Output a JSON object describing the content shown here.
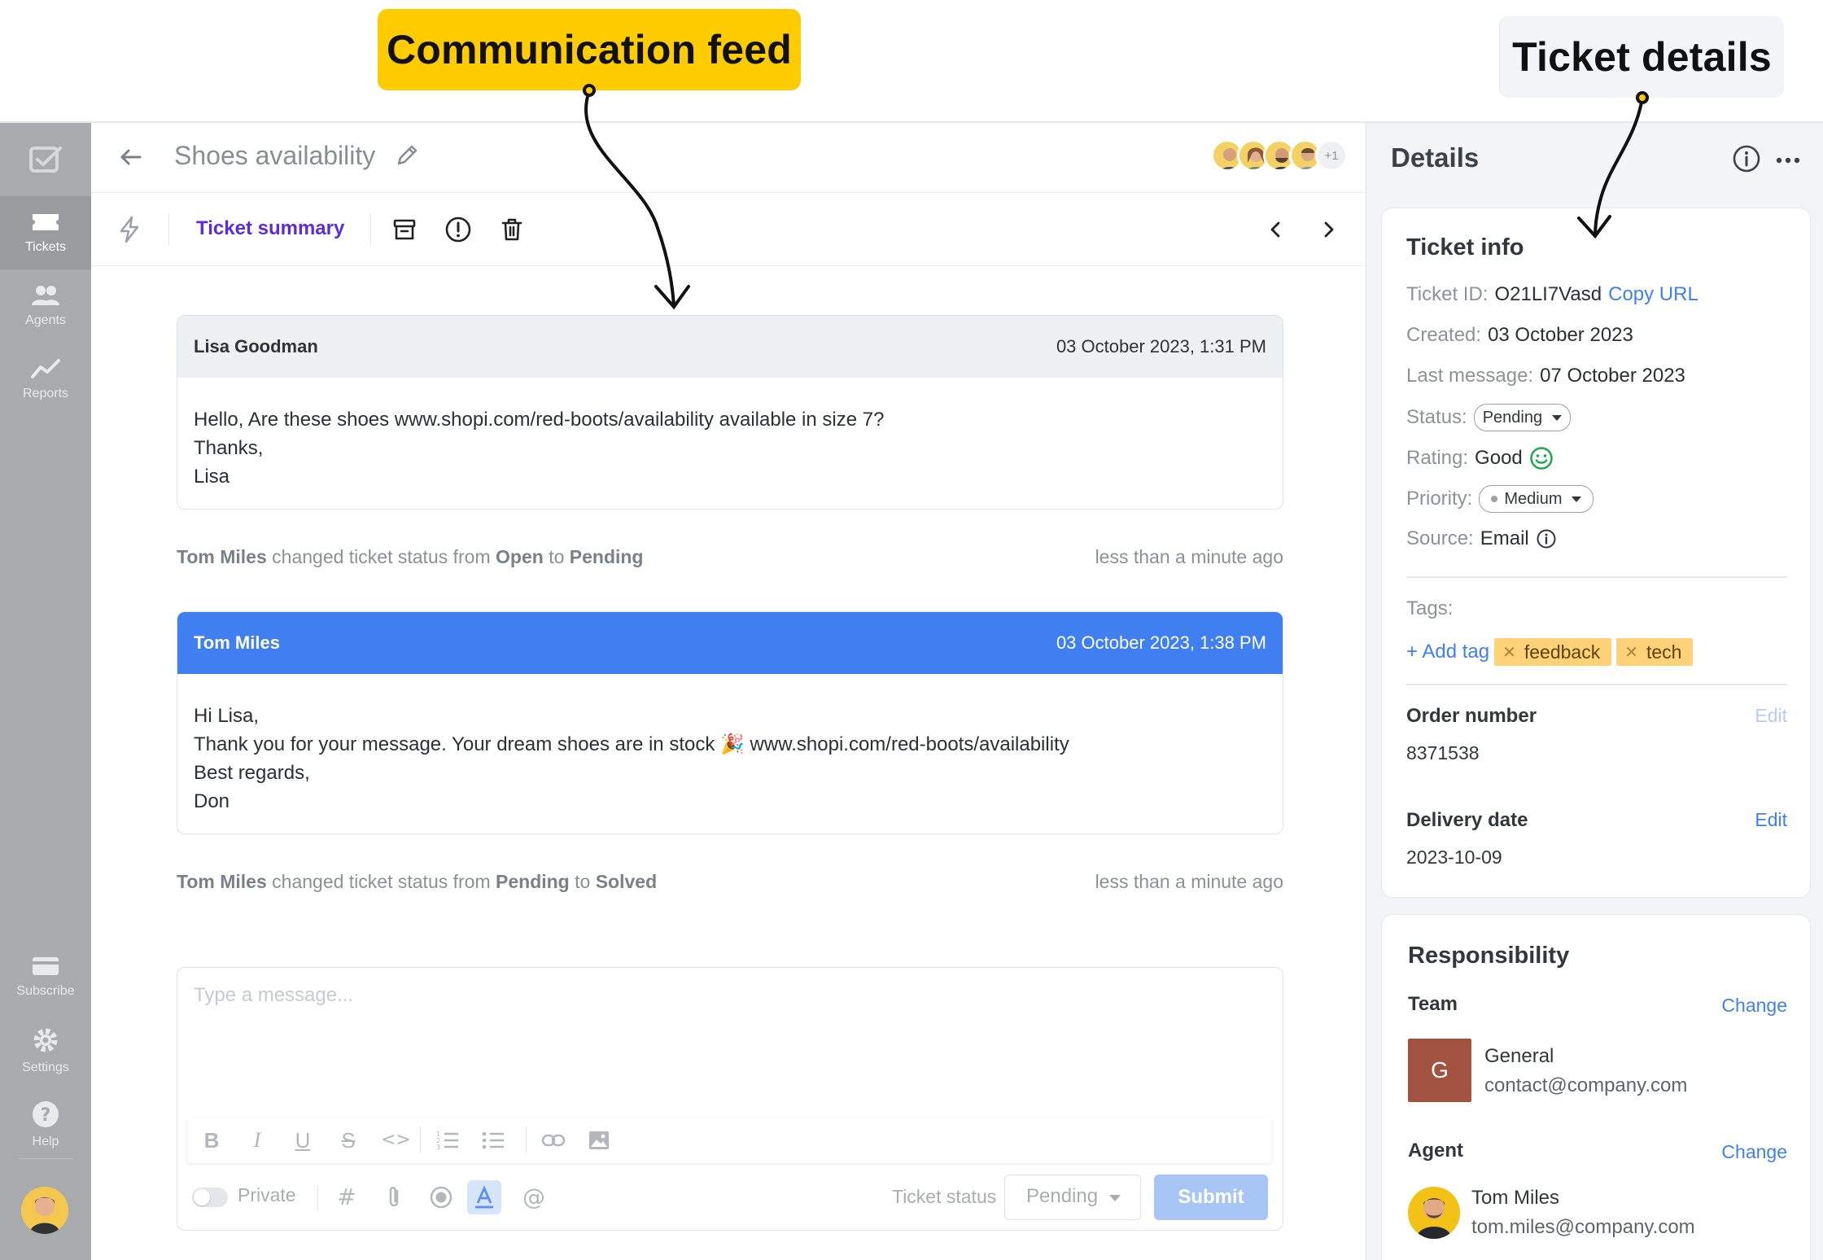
{
  "callouts": {
    "feed": "Communication feed",
    "details": "Ticket details"
  },
  "rail": {
    "items": [
      {
        "label": "Tickets",
        "icon": "ticket-icon",
        "active": true
      },
      {
        "label": "Agents",
        "icon": "agents-icon",
        "active": false
      },
      {
        "label": "Reports",
        "icon": "reports-icon",
        "active": false
      }
    ],
    "bottom": [
      {
        "label": "Subscribe",
        "icon": "card-icon"
      },
      {
        "label": "Settings",
        "icon": "gear-icon"
      },
      {
        "label": "Help",
        "icon": "help-icon"
      }
    ]
  },
  "header": {
    "title": "Shoes availability",
    "participants_more": "+1"
  },
  "toolbar": {
    "summary_label": "Ticket summary"
  },
  "feed": {
    "messages": [
      {
        "author": "Lisa Goodman",
        "time": "03 October 2023, 1:31 PM",
        "lines": [
          "Hello, Are these shoes www.shopi.com/red-boots/availability  available in size 7?",
          "Thanks,",
          "Lisa"
        ]
      },
      {
        "author": "Tom Miles",
        "time": "03 October 2023, 1:38 PM",
        "lines": [
          "Hi Lisa,",
          "Thank you for your message. Your dream shoes are in stock 🎉 www.shopi.com/red-boots/availability",
          "Best regards,",
          "Don"
        ]
      }
    ],
    "events": [
      {
        "actor": "Tom Miles",
        "text": "changed ticket status from",
        "from": "Open",
        "to_word": "to",
        "to": "Pending",
        "time": "less than a minute ago"
      },
      {
        "actor": "Tom Miles",
        "text": "changed ticket status from",
        "from": "Pending",
        "to_word": "to",
        "to": "Solved",
        "time": "less than a minute ago"
      }
    ]
  },
  "composer": {
    "placeholder": "Type a message...",
    "private_label": "Private",
    "status_label": "Ticket status",
    "status_value": "Pending",
    "submit_label": "Submit"
  },
  "details": {
    "title": "Details",
    "ticket_info": {
      "heading": "Ticket info",
      "id_label": "Ticket ID:",
      "id_value": "O21LI7Vasd",
      "copy_url": "Copy URL",
      "created_label": "Created:",
      "created_value": "03 October 2023",
      "last_label": "Last message:",
      "last_value": "07 October 2023",
      "status_label": "Status:",
      "status_value": "Pending",
      "rating_label": "Rating:",
      "rating_value": "Good",
      "priority_label": "Priority:",
      "priority_value": "Medium",
      "source_label": "Source:",
      "source_value": "Email",
      "tags_label": "Tags:",
      "add_tag": "+ Add tag",
      "tags": [
        "feedback",
        "tech"
      ],
      "order_label": "Order number",
      "order_value": "8371538",
      "order_edit": "Edit",
      "delivery_label": "Delivery date",
      "delivery_value": "2023-10-09",
      "delivery_edit": "Edit"
    },
    "responsibility": {
      "heading": "Responsibility",
      "team_label": "Team",
      "team_change": "Change",
      "team_initial": "G",
      "team_name": "General",
      "team_email": "contact@company.com",
      "agent_label": "Agent",
      "agent_change": "Change",
      "agent_name": "Tom Miles",
      "agent_email": "tom.miles@company.com"
    }
  },
  "colors": {
    "accent_blue": "#3f7ff0",
    "summary_purple": "#5b2be0",
    "callout_yellow": "#ffcc00",
    "tag_orange": "#ffd27a",
    "team_badge": "#a2533f"
  }
}
